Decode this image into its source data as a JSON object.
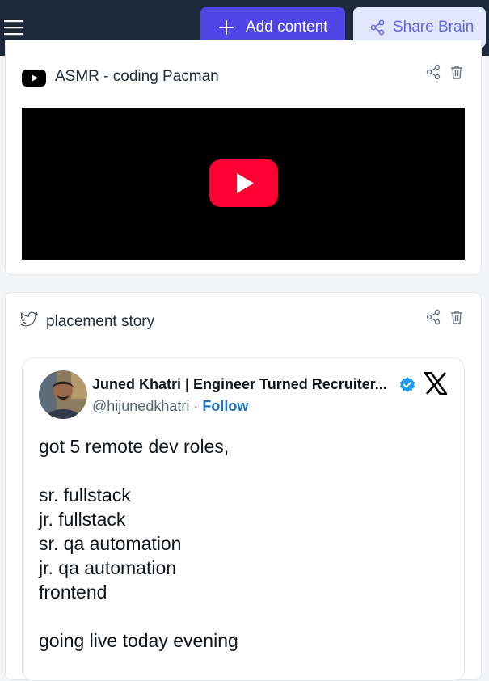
{
  "header": {
    "add_label": "Add content",
    "share_label": "Share Brain"
  },
  "cards": [
    {
      "title": "ASMR - coding Pacman",
      "type": "youtube"
    },
    {
      "title": "placement story",
      "type": "twitter",
      "tweet": {
        "author": "Juned Khatri | Engineer Turned Recruiter...",
        "handle": "@hijunedkhatri",
        "separator": " · ",
        "follow_label": "Follow",
        "body": "got 5 remote dev roles,\n\nsr. fullstack\njr. fullstack\nsr. qa automation\njr. qa automation\nfrontend\n\ngoing live today evening"
      }
    }
  ],
  "colors": {
    "topbar": "#1e293b",
    "primary": "#4f46e5",
    "secondary_bg": "#e0e7ff",
    "secondary_text": "#6366f1",
    "youtube_red": "#ff0033",
    "verified_blue": "#1d9bf0",
    "follow_blue": "#1d72c4"
  },
  "icons": [
    "menu-icon",
    "plus-icon",
    "share-icon",
    "youtube-icon",
    "trash-icon",
    "twitter-bird-icon",
    "verified-badge-icon",
    "x-logo-icon",
    "play-icon"
  ]
}
